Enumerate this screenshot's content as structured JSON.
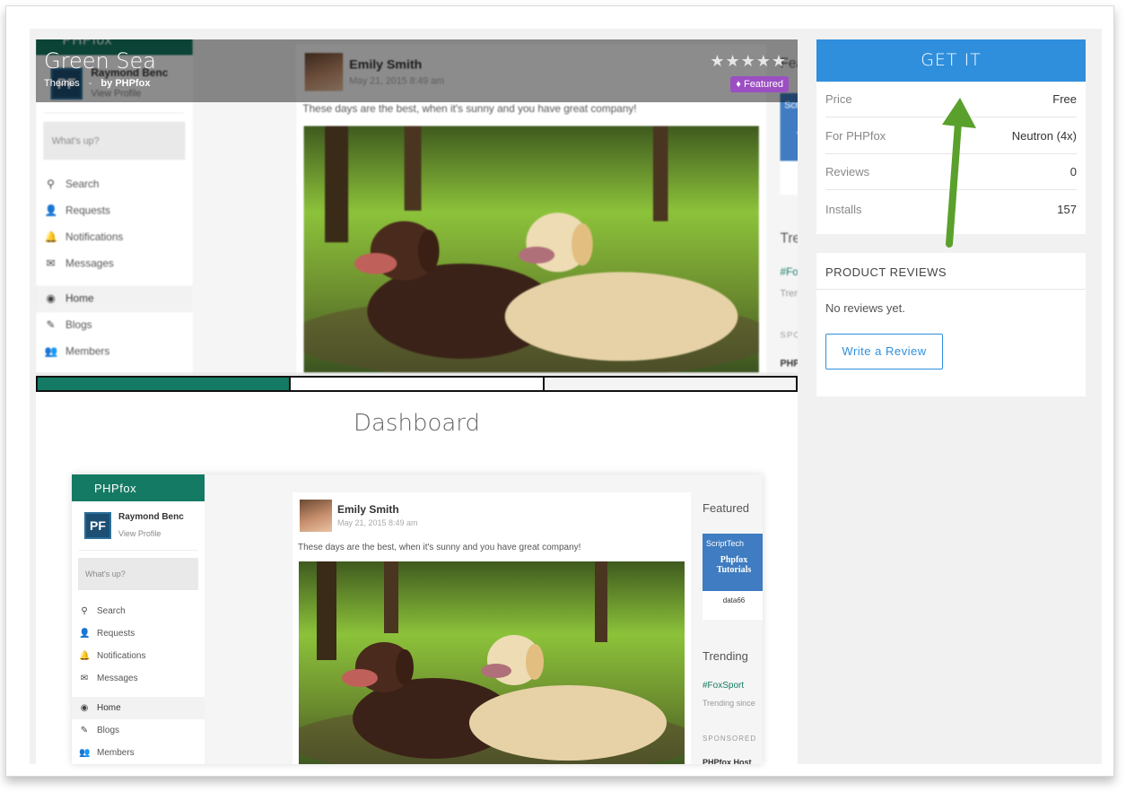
{
  "product": {
    "title": "Green Sea",
    "crumb_category": "Themes",
    "crumb_separator": "-",
    "crumb_author": "by PHPfox",
    "stars": "★★★★★",
    "featured_label": "Featured"
  },
  "carousel": {
    "slide_count": 3,
    "active_index": 0,
    "caption": "Dashboard"
  },
  "preview_app": {
    "brand": "PHPfox",
    "avatar_text": "PF",
    "user_name": "Raymond Benc",
    "view_profile": "View Profile",
    "whats_up": "What's up?",
    "nav": [
      {
        "icon": "search-icon",
        "glyph": "⚲",
        "label": "Search"
      },
      {
        "icon": "requests-icon",
        "glyph": "👤",
        "label": "Requests"
      },
      {
        "icon": "bell-icon",
        "glyph": "🔔",
        "label": "Notifications"
      },
      {
        "icon": "envelope-icon",
        "glyph": "✉",
        "label": "Messages"
      },
      {
        "icon": "home-icon",
        "glyph": "◉",
        "label": "Home"
      },
      {
        "icon": "blog-icon",
        "glyph": "✎",
        "label": "Blogs"
      },
      {
        "icon": "members-icon",
        "glyph": "👥",
        "label": "Members"
      }
    ],
    "post": {
      "author": "Emily Smith",
      "date": "May 21, 2015 8:49 am",
      "text": "These days are the best, when it's sunny and you have great company!"
    },
    "right": {
      "featured": "Featured",
      "ad_brand": "ScriptTech",
      "ad_title": "Phpfox Tutorials",
      "ad_caption": "data66",
      "trending": "Trending",
      "tag": "#FoxSport",
      "trending_since": "Trending since",
      "sponsored": "SPONSORED",
      "sponsored_item": "PHPfox Host"
    }
  },
  "sidebar": {
    "get_it": "GET IT",
    "info": [
      {
        "label": "Price",
        "value": "Free"
      },
      {
        "label": "For PHPfox",
        "value": "Neutron (4x)"
      },
      {
        "label": "Reviews",
        "value": "0"
      },
      {
        "label": "Installs",
        "value": "157"
      }
    ],
    "reviews_heading": "PRODUCT REVIEWS",
    "no_reviews": "No reviews yet.",
    "write_review": "Write a Review"
  },
  "colors": {
    "accent_blue": "#2f8fdd",
    "brand_green": "#157a63",
    "featured_purple": "#9b4fc3",
    "arrow_green": "#5aa02c"
  }
}
